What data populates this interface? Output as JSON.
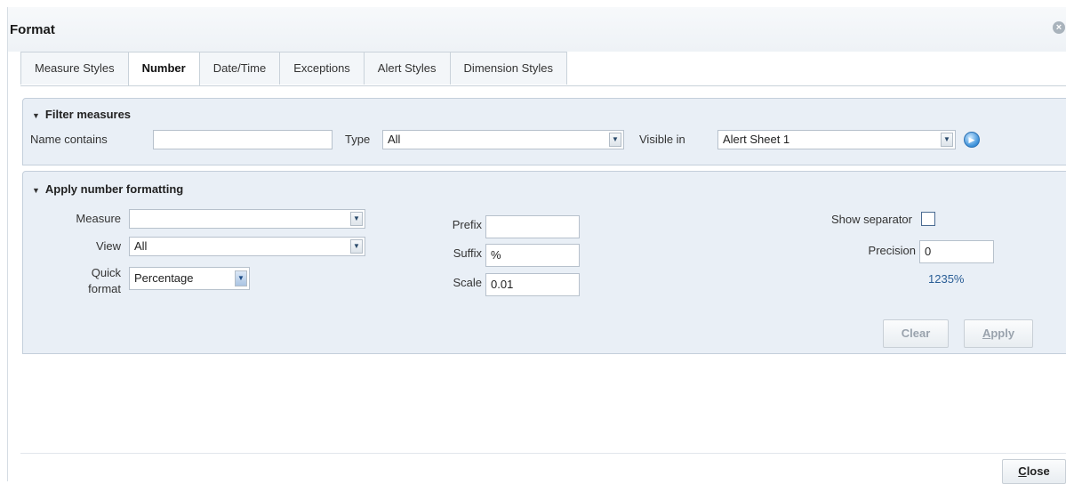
{
  "dialog": {
    "title": "Format"
  },
  "tabs": [
    {
      "label": "Measure Styles"
    },
    {
      "label": "Number"
    },
    {
      "label": "Date/Time"
    },
    {
      "label": "Exceptions"
    },
    {
      "label": "Alert Styles"
    },
    {
      "label": "Dimension Styles"
    }
  ],
  "active_tab": "Number",
  "filter": {
    "heading": "Filter measures",
    "name_label": "Name contains",
    "name_value": "",
    "type_label": "Type",
    "type_value": "All",
    "visible_label": "Visible in",
    "visible_value": "Alert Sheet 1"
  },
  "formatting": {
    "heading": "Apply number formatting",
    "measure_label": "Measure",
    "measure_value": "",
    "view_label": "View",
    "view_value": "All",
    "quick_label_1": "Quick",
    "quick_label_2": "format",
    "quick_value": "Percentage",
    "prefix_label": "Prefix",
    "prefix_value": "",
    "suffix_label": "Suffix",
    "suffix_value": "%",
    "scale_label": "Scale",
    "scale_value": "0.01",
    "separator_label": "Show separator",
    "separator_checked": false,
    "precision_label": "Precision",
    "precision_value": "0",
    "preview": "1235%",
    "clear_label": "Clear",
    "apply_first": "A",
    "apply_rest": "pply"
  },
  "footer": {
    "close_first": "C",
    "close_rest": "lose"
  },
  "colors": {
    "panel_bg": "#e9eff6",
    "preview_text": "#2a5e96",
    "accent_blue": "#3a8fd8"
  }
}
